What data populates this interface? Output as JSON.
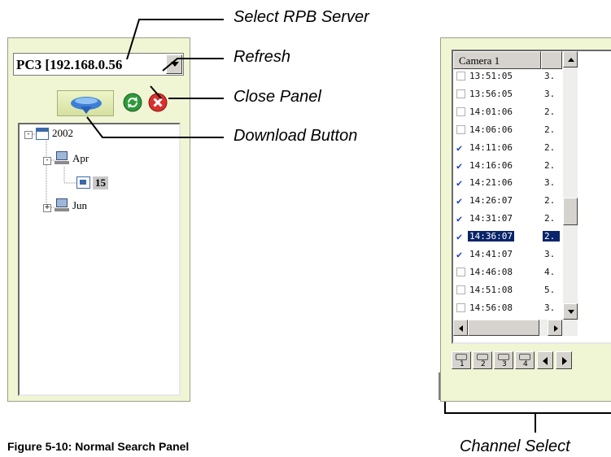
{
  "callouts": {
    "select_server": "Select RPB Server",
    "refresh": "Refresh",
    "close_panel": "Close Panel",
    "download_button": "Download Button",
    "channel_select": "Channel Select"
  },
  "left_panel": {
    "server_value": "PC3 [192.168.0.56",
    "tree": {
      "year": "2002",
      "months": [
        {
          "label": "Apr",
          "days": [
            "15"
          ]
        },
        {
          "label": "Jun"
        }
      ]
    }
  },
  "right_panel": {
    "header": "Camera 1",
    "rows": [
      {
        "time": "13:51:05",
        "val": "3.",
        "checked": false
      },
      {
        "time": "13:56:05",
        "val": "3.",
        "checked": false
      },
      {
        "time": "14:01:06",
        "val": "2.",
        "checked": false
      },
      {
        "time": "14:06:06",
        "val": "2.",
        "checked": false
      },
      {
        "time": "14:11:06",
        "val": "2.",
        "checked": true
      },
      {
        "time": "14:16:06",
        "val": "2.",
        "checked": true
      },
      {
        "time": "14:21:06",
        "val": "3.",
        "checked": true
      },
      {
        "time": "14:26:07",
        "val": "2.",
        "checked": true
      },
      {
        "time": "14:31:07",
        "val": "2.",
        "checked": true
      },
      {
        "time": "14:36:07",
        "val": "2.",
        "checked": true,
        "selected": true
      },
      {
        "time": "14:41:07",
        "val": "3.",
        "checked": true
      },
      {
        "time": "14:46:08",
        "val": "4.",
        "checked": false
      },
      {
        "time": "14:51:08",
        "val": "5.",
        "checked": false
      },
      {
        "time": "14:56:08",
        "val": "3.",
        "checked": false
      }
    ],
    "channel_tabs": [
      "1",
      "2",
      "3",
      "4"
    ]
  },
  "figure_caption": "Figure 5-10:  Normal Search Panel",
  "colors": {
    "panel_bg": "#f0f5d4",
    "selection": "#0a246a",
    "check": "#1a3fc0"
  }
}
